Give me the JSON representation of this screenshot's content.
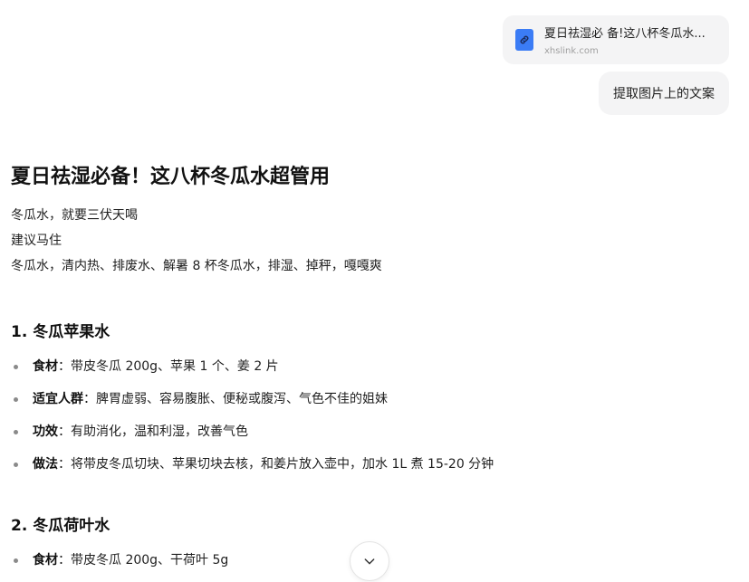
{
  "user_messages": {
    "link_card": {
      "title": "夏日祛湿必 备!这八杯冬瓜水...",
      "domain": "xhslink.com",
      "icon": "link-document-icon"
    },
    "prompt": "提取图片上的文案"
  },
  "answer": {
    "title": "夏日祛湿必备！这八杯冬瓜水超管用",
    "intro": [
      "冬瓜水，就要三伏天喝",
      "建议马住",
      "冬瓜水，清内热、排废水、解暑 8 杯冬瓜水，排湿、掉秤，嘎嘎爽"
    ],
    "sections": [
      {
        "heading": "1. 冬瓜苹果水",
        "items": [
          {
            "label": "食材",
            "text": "：带皮冬瓜 200g、苹果 1 个、姜 2 片"
          },
          {
            "label": "适宜人群",
            "text": "：脾胃虚弱、容易腹胀、便秘或腹泻、气色不佳的姐妹"
          },
          {
            "label": "功效",
            "text": "：有助消化，温和利湿，改善气色"
          },
          {
            "label": "做法",
            "text": "：将带皮冬瓜切块、苹果切块去核，和姜片放入壶中，加水 1L 煮 15-20 分钟"
          }
        ]
      },
      {
        "heading": "2. 冬瓜荷叶水",
        "items": [
          {
            "label": "食材",
            "text": "：带皮冬瓜 200g、干荷叶 5g"
          }
        ]
      }
    ]
  },
  "controls": {
    "scroll_down_icon": "chevron-down-icon"
  },
  "colors": {
    "bubble_bg": "#f4f4f5",
    "link_icon": "#3b7cf5"
  }
}
